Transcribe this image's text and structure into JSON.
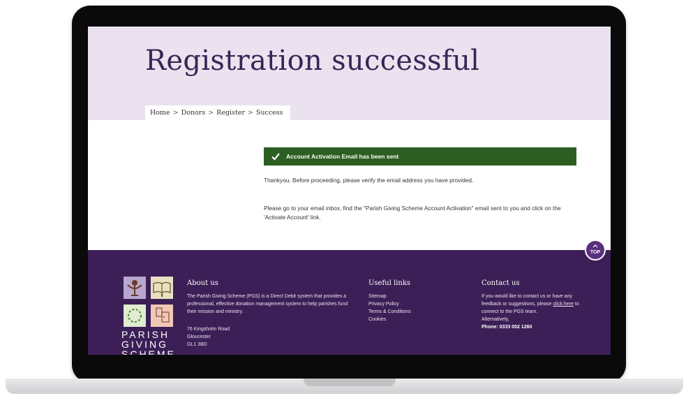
{
  "page": {
    "title": "Registration successful",
    "breadcrumb": [
      "Home",
      "Donors",
      "Register",
      "Success"
    ],
    "breadcrumb_separator": ">"
  },
  "alert": {
    "text": "Account Activation Email has been sent",
    "color": "#2c5e22"
  },
  "messages": {
    "verify": "Thankyou. Before proceeding, please verify the email address you have provided.",
    "instructions": "Please go to your email inbox, find the \"Parish Giving Scheme Account Activation\" email sent to you and click on the 'Activate Account' link."
  },
  "footer": {
    "background": "#3c1f56",
    "logo_text": [
      "PARISH",
      "GIVING",
      "SCHEME"
    ],
    "about": {
      "title": "About us",
      "text": "The Parish Giving Scheme (PGS) is a Direct Debit system that provides a professional, effective donation management system to help parishes fund their mission and ministry.",
      "address": [
        "76 Kingsholm Road",
        "Gloucester",
        "GL1 3BD"
      ]
    },
    "links": {
      "title": "Useful links",
      "items": [
        "Sitemap",
        "Privacy Policy",
        "Terms & Conditions",
        "Cookies"
      ]
    },
    "contact": {
      "title": "Contact us",
      "text1": "If you would like to contact us or have any feedback or suggestions, please",
      "link": "click here",
      "text2": "to connect to the PGS team.",
      "alt": "Alternatively,",
      "phone": "Phone: 0333 002 1260"
    }
  },
  "top_button": {
    "label": "TOP"
  }
}
